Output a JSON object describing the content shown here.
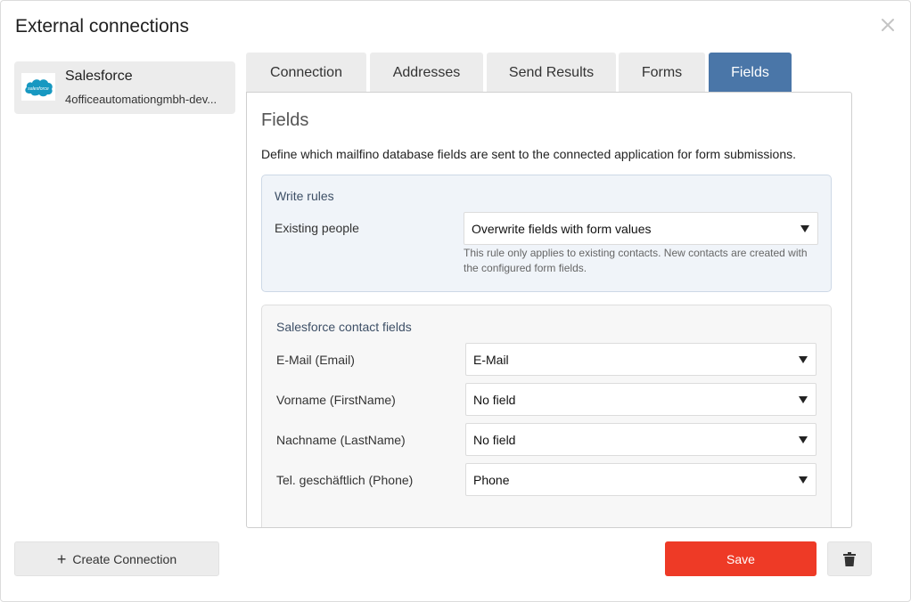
{
  "dialog": {
    "title": "External connections",
    "close_icon": "close-icon"
  },
  "connections": [
    {
      "name": "Salesforce",
      "account": "4officeautomationgmbh-dev...",
      "logo_text": "salesforce",
      "logo_color": "#1798c1"
    }
  ],
  "tabs": [
    {
      "label": "Connection",
      "active": false
    },
    {
      "label": "Addresses",
      "active": false
    },
    {
      "label": "Send Results",
      "active": false
    },
    {
      "label": "Forms",
      "active": false
    },
    {
      "label": "Fields",
      "active": true
    }
  ],
  "panel": {
    "title": "Fields",
    "description": "Define which mailfino database fields are sent to the connected application for form submissions.",
    "write_rules": {
      "title": "Write rules",
      "label": "Existing people",
      "value": "Overwrite fields with form values",
      "hint": "This rule only applies to existing contacts. New contacts are created with the configured form fields."
    },
    "contact_fields": {
      "title": "Salesforce contact fields",
      "rows": [
        {
          "label": "E-Mail (Email)",
          "value": "E-Mail"
        },
        {
          "label": "Vorname (FirstName)",
          "value": "No field"
        },
        {
          "label": "Nachname (LastName)",
          "value": "No field"
        },
        {
          "label": "Tel. geschäftlich (Phone)",
          "value": "Phone"
        }
      ]
    }
  },
  "footer": {
    "create_label": "Create Connection",
    "save_label": "Save",
    "delete_icon": "trash-icon"
  },
  "colors": {
    "active_tab": "#4a76a8",
    "save_button": "#ee3a26",
    "rules_background": "#f0f4f9"
  }
}
